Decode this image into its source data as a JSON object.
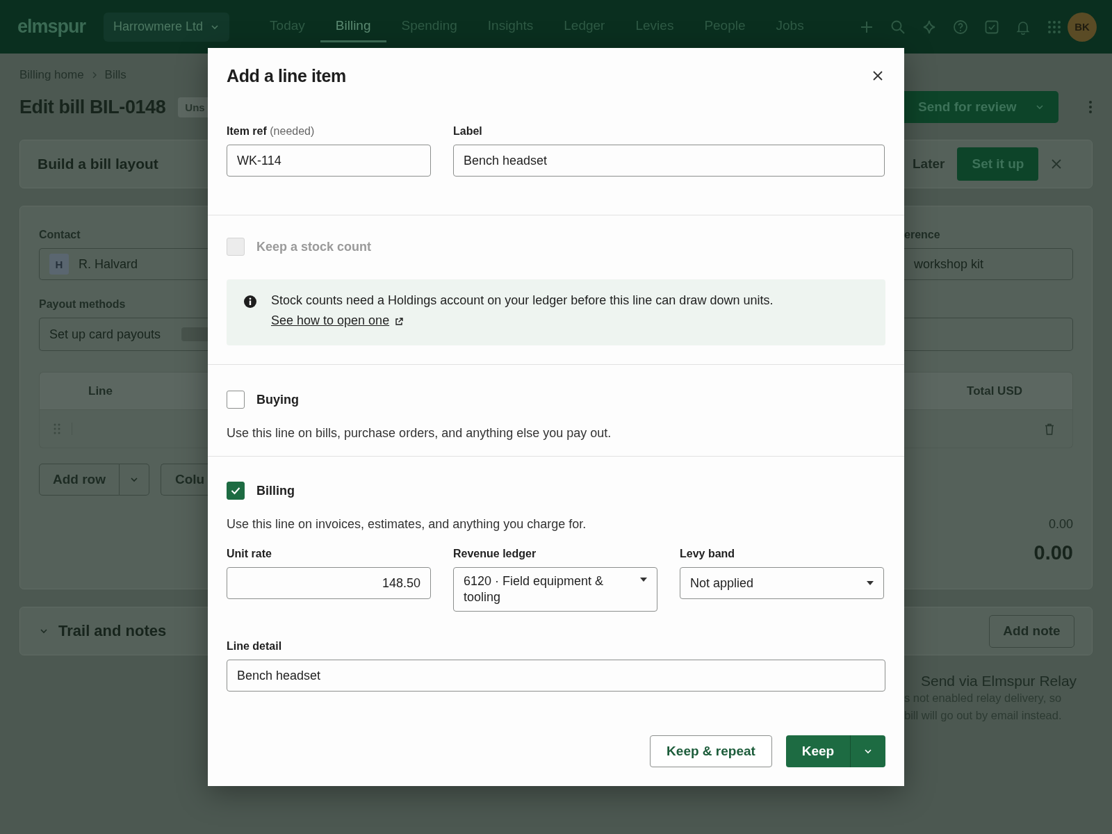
{
  "top_bar": {
    "logo": "elmspur",
    "org_switcher": "Harrowmere Ltd",
    "nav": [
      {
        "label": "Today",
        "selected": false
      },
      {
        "label": "Billing",
        "selected": true
      },
      {
        "label": "Spending",
        "selected": false
      },
      {
        "label": "Insights",
        "selected": false
      },
      {
        "label": "Ledger",
        "selected": false
      },
      {
        "label": "Levies",
        "selected": false
      },
      {
        "label": "People",
        "selected": false
      },
      {
        "label": "Jobs",
        "selected": false
      }
    ],
    "avatar": "BK"
  },
  "page": {
    "breadcrumbs": [
      "Billing home",
      "Bills"
    ],
    "title": "Edit bill BIL-0148",
    "status_badge": "Uns",
    "primary_action": "Send for review",
    "setup_banner": {
      "title": "Build a bill layout",
      "later": "Later",
      "action": "Set it up"
    },
    "form": {
      "contact": {
        "label": "Contact",
        "initial": "H",
        "value": "R. Halvard"
      },
      "reference": {
        "label": "erence",
        "value": "workshop kit"
      },
      "payout": {
        "label": "Payout methods",
        "value": "Set up card payouts"
      },
      "table": {
        "columns": [
          "Line",
          "Total USD"
        ]
      },
      "add_row": "Add row",
      "columns_button": "Colu",
      "subtotal": "0.00",
      "total": "0.00"
    },
    "trail": {
      "title": "Trail and notes",
      "add_note": "Add note"
    },
    "relay": {
      "label": "Send via Elmspur Relay",
      "note_lines": [
        "s not enabled relay delivery, so",
        "bill will go out by email instead."
      ]
    }
  },
  "dialog": {
    "title": "Add a line item",
    "fields": [
      {
        "label": "Item ref",
        "hint": "(needed)",
        "value": "WK-114"
      },
      {
        "label": "Label",
        "value": "Bench headset"
      }
    ],
    "stock": {
      "label": "Keep a stock count",
      "checked": false,
      "disabled": true
    },
    "notice": {
      "text": "Stock counts need a Holdings account on your ledger before this line can draw down units.",
      "link": "See how to open one"
    },
    "uses": [
      {
        "label": "Buying",
        "checked": false,
        "description": "Use this line on bills, purchase orders, and anything else you pay out."
      },
      {
        "label": "Billing",
        "checked": true,
        "description": "Use this line on invoices, estimates, and anything you charge for."
      }
    ],
    "billing_fields": [
      {
        "label": "Unit rate",
        "kind": "number",
        "value": "148.50"
      },
      {
        "label": "Revenue ledger",
        "kind": "select",
        "value": "6120 · Field equipment & tooling"
      },
      {
        "label": "Levy band",
        "kind": "select",
        "value": "Not applied"
      }
    ],
    "line_detail": {
      "label": "Line detail",
      "value": "Bench headset"
    },
    "buttons": {
      "secondary": "Keep & repeat",
      "primary": "Keep"
    }
  }
}
